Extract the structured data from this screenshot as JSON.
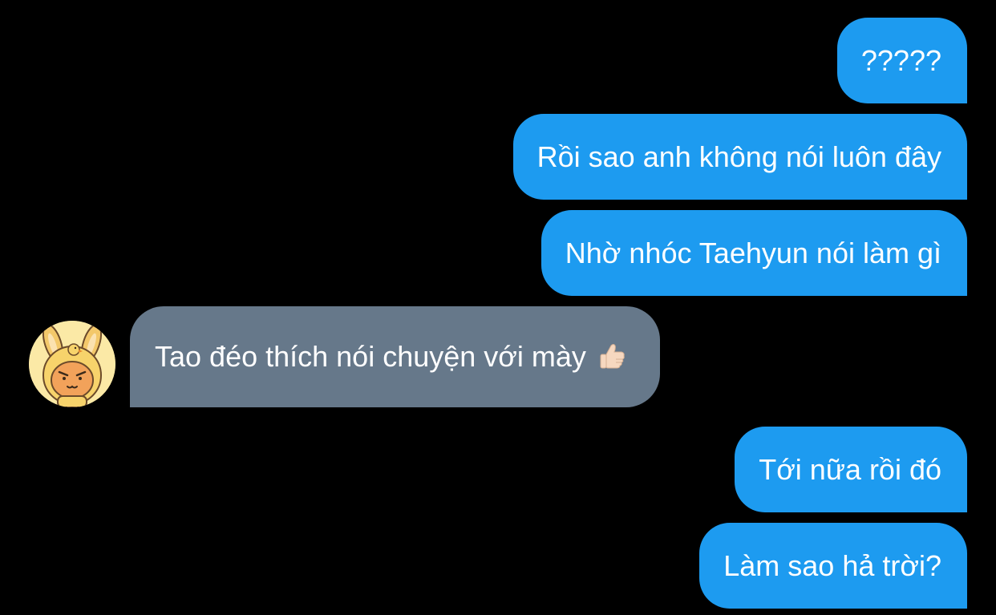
{
  "conversation": {
    "messages": [
      {
        "direction": "outgoing",
        "text": "?????"
      },
      {
        "direction": "outgoing",
        "text": "Rồi sao anh không nói luôn đây"
      },
      {
        "direction": "outgoing",
        "text": "Nhờ nhóc Taehyun nói làm gì"
      },
      {
        "direction": "incoming",
        "text": "Tao đéo thích nói chuyện với mày",
        "emoji": "thumbs-up"
      },
      {
        "direction": "outgoing",
        "text": "Tới nữa rồi đó"
      },
      {
        "direction": "outgoing",
        "text": "Làm sao hả trời?"
      }
    ]
  },
  "colors": {
    "background": "#000000",
    "outgoing_bubble": "#1d9bf0",
    "incoming_bubble": "#66788a",
    "text": "#ffffff"
  },
  "icons": {
    "avatar": "cartoon-bunny-avatar-icon",
    "reaction": "thumbs-up-icon"
  }
}
